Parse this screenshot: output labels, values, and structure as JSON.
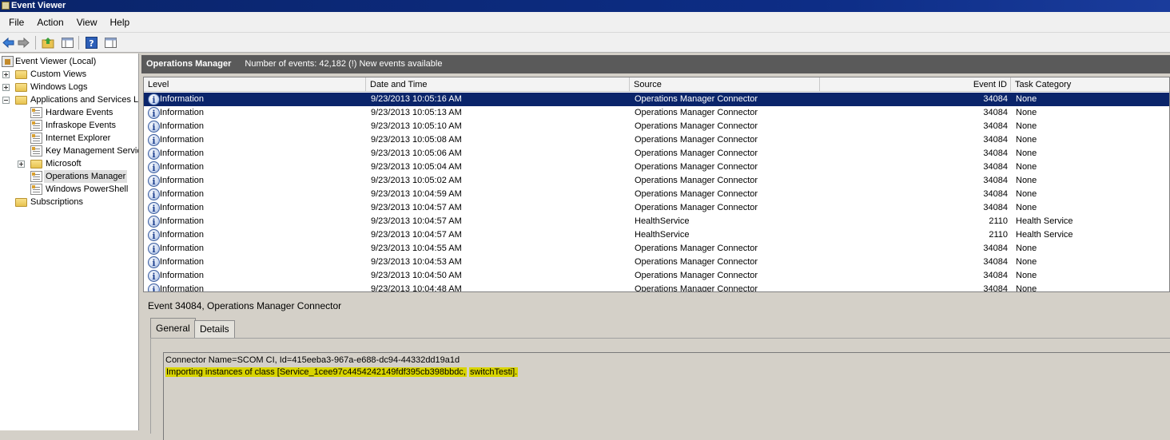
{
  "window": {
    "title": "Event Viewer"
  },
  "menu": [
    "File",
    "Action",
    "View",
    "Help"
  ],
  "toolbar": {
    "icons": [
      "back-arrow-icon",
      "forward-arrow-icon",
      "up-folder-icon",
      "show-hide-console-tree-icon",
      "help-icon",
      "show-hide-action-pane-icon"
    ]
  },
  "tree": {
    "items": [
      {
        "label": "Event Viewer (Local)",
        "icon": "event-viewer-icon",
        "expander": "none"
      },
      {
        "label": "Custom Views",
        "icon": "folder-icon",
        "expander": "plus"
      },
      {
        "label": "Windows Logs",
        "icon": "folder-icon",
        "expander": "plus"
      },
      {
        "label": "Applications and Services Lo",
        "icon": "folder-icon",
        "expander": "minus"
      },
      {
        "label": "Hardware Events",
        "icon": "log-icon",
        "expander": "none"
      },
      {
        "label": "Infraskope Events",
        "icon": "log-icon",
        "expander": "none"
      },
      {
        "label": "Internet Explorer",
        "icon": "log-icon",
        "expander": "none"
      },
      {
        "label": "Key Management Servic",
        "icon": "log-icon",
        "expander": "none"
      },
      {
        "label": "Microsoft",
        "icon": "folder-icon",
        "expander": "plus"
      },
      {
        "label": "Operations Manager",
        "icon": "log-icon",
        "expander": "none",
        "selected": true
      },
      {
        "label": "Windows PowerShell",
        "icon": "log-icon",
        "expander": "none"
      },
      {
        "label": "Subscriptions",
        "icon": "folder-icon",
        "expander": "none"
      }
    ]
  },
  "list": {
    "title": "Operations Manager",
    "count": "Number of events: 42,182 (!) New events available",
    "columns": [
      "Level",
      "Date and Time",
      "Source",
      "Event ID",
      "Task Category"
    ],
    "rows": [
      {
        "level": "Information",
        "datetime": "9/23/2013 10:05:16 AM",
        "source": "Operations Manager Connector",
        "event_id": "34084",
        "category": "None",
        "selected": true
      },
      {
        "level": "Information",
        "datetime": "9/23/2013 10:05:13 AM",
        "source": "Operations Manager Connector",
        "event_id": "34084",
        "category": "None"
      },
      {
        "level": "Information",
        "datetime": "9/23/2013 10:05:10 AM",
        "source": "Operations Manager Connector",
        "event_id": "34084",
        "category": "None"
      },
      {
        "level": "Information",
        "datetime": "9/23/2013 10:05:08 AM",
        "source": "Operations Manager Connector",
        "event_id": "34084",
        "category": "None"
      },
      {
        "level": "Information",
        "datetime": "9/23/2013 10:05:06 AM",
        "source": "Operations Manager Connector",
        "event_id": "34084",
        "category": "None"
      },
      {
        "level": "Information",
        "datetime": "9/23/2013 10:05:04 AM",
        "source": "Operations Manager Connector",
        "event_id": "34084",
        "category": "None"
      },
      {
        "level": "Information",
        "datetime": "9/23/2013 10:05:02 AM",
        "source": "Operations Manager Connector",
        "event_id": "34084",
        "category": "None"
      },
      {
        "level": "Information",
        "datetime": "9/23/2013 10:04:59 AM",
        "source": "Operations Manager Connector",
        "event_id": "34084",
        "category": "None"
      },
      {
        "level": "Information",
        "datetime": "9/23/2013 10:04:57 AM",
        "source": "Operations Manager Connector",
        "event_id": "34084",
        "category": "None"
      },
      {
        "level": "Information",
        "datetime": "9/23/2013 10:04:57 AM",
        "source": "HealthService",
        "event_id": "2110",
        "category": "Health Service"
      },
      {
        "level": "Information",
        "datetime": "9/23/2013 10:04:57 AM",
        "source": "HealthService",
        "event_id": "2110",
        "category": "Health Service"
      },
      {
        "level": "Information",
        "datetime": "9/23/2013 10:04:55 AM",
        "source": "Operations Manager Connector",
        "event_id": "34084",
        "category": "None"
      },
      {
        "level": "Information",
        "datetime": "9/23/2013 10:04:53 AM",
        "source": "Operations Manager Connector",
        "event_id": "34084",
        "category": "None"
      },
      {
        "level": "Information",
        "datetime": "9/23/2013 10:04:50 AM",
        "source": "Operations Manager Connector",
        "event_id": "34084",
        "category": "None"
      },
      {
        "level": "Information",
        "datetime": "9/23/2013 10:04:48 AM",
        "source": "Operations Manager Connector",
        "event_id": "34084",
        "category": "None"
      }
    ]
  },
  "detail": {
    "title": "Event 34084, Operations Manager Connector",
    "tabs": [
      "General",
      "Details"
    ],
    "active_tab": "General",
    "line1": "Connector Name=SCOM CI, Id=415eeba3-967a-e688-dc94-44332dd19a1d",
    "line2_part1": "Importing instances of class [Service_1cee97c4454242149fdf395cb398bbdc,",
    "line2_part2": "switchTesti].",
    "highlight_color": "#d8d400"
  }
}
